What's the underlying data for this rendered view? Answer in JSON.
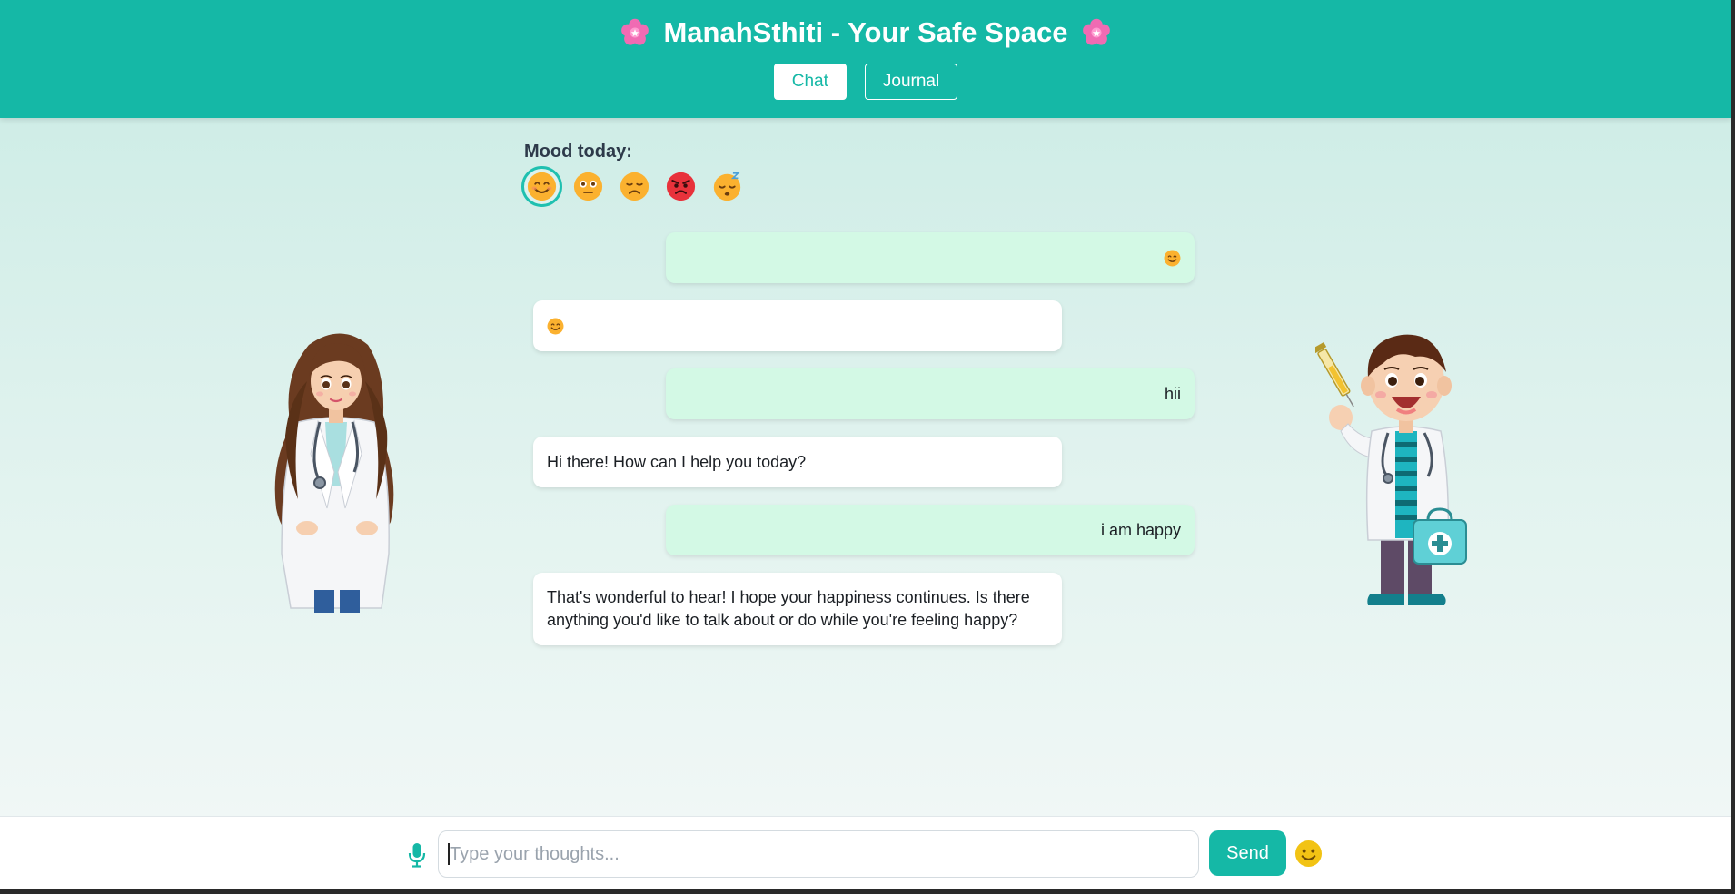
{
  "header": {
    "title": "ManahSthiti - Your Safe Space",
    "left_icon": "cherry-blossom-icon",
    "right_icon": "cherry-blossom-icon",
    "tabs": [
      {
        "label": "Chat",
        "active": true
      },
      {
        "label": "Journal",
        "active": false
      }
    ],
    "color": "#15b8a6"
  },
  "mood": {
    "label": "Mood today:",
    "options": [
      {
        "icon": "smiling-face-icon",
        "selected": true
      },
      {
        "icon": "flushed-face-icon",
        "selected": false
      },
      {
        "icon": "sad-face-icon",
        "selected": false
      },
      {
        "icon": "angry-face-icon",
        "selected": false
      },
      {
        "icon": "sleepy-face-icon",
        "selected": false
      }
    ]
  },
  "messages": [
    {
      "sender": "user",
      "icon": "smiling-face-icon",
      "text": ""
    },
    {
      "sender": "bot",
      "icon": "smiling-face-icon",
      "text": ""
    },
    {
      "sender": "user",
      "text": "hii"
    },
    {
      "sender": "bot",
      "text": "Hi there! How can I help you today?"
    },
    {
      "sender": "user",
      "text": "i am happy"
    },
    {
      "sender": "bot",
      "text": "That's wonderful to hear! I hope your happiness continues.  Is there anything you'd like to talk about or do while you're feeling happy?"
    }
  ],
  "illustrations": {
    "left": "female-doctor-illustration",
    "right": "boy-doctor-illustration"
  },
  "composer": {
    "placeholder": "Type your thoughts...",
    "value": "",
    "send_label": "Send",
    "mic_icon": "microphone-icon",
    "emoji_icon": "emoji-picker-icon"
  },
  "colors": {
    "accent": "#15b8a6",
    "user_bubble": "#d3f9e5",
    "bot_bubble": "#ffffff"
  }
}
